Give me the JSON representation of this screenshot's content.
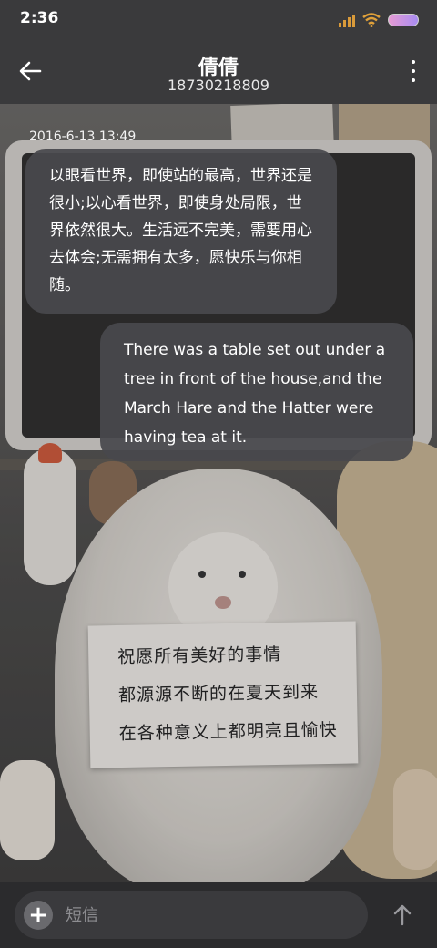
{
  "status_bar": {
    "time": "2:36",
    "icons": [
      "signal-icon",
      "wifi-icon",
      "battery-icon"
    ],
    "signal_color": "#d99a3a",
    "wifi_color": "#e0a13a"
  },
  "header": {
    "contact_name": "倩倩",
    "phone_number": "18730218809",
    "back_icon": "back-arrow-icon",
    "more_icon": "more-vertical-icon"
  },
  "conversation": {
    "timestamp": "2016-6-13 13:49",
    "messages": [
      {
        "direction": "incoming",
        "text": "以眼看世界，即使站的最高，世界还是很小;以心看世界，即使身处局限，世界依然很大。生活远不完美，需要用心去体会;无需拥有太多，愿快乐与你相随。"
      },
      {
        "direction": "outgoing",
        "text": "There was a table set out under a tree in front of the house,and the March Hare and the Hatter were having tea at it."
      }
    ]
  },
  "background_photo": {
    "note_lines": [
      "祝愿所有美好的事情",
      "都源源不断的在夏天到来",
      "在各种意义上都明亮且愉快"
    ]
  },
  "composer": {
    "placeholder": "短信",
    "value": "",
    "add_icon": "plus-icon",
    "send_icon": "send-arrow-up-icon"
  },
  "colors": {
    "bubble_bg": "#48484c",
    "header_bg": "#3a3a3c",
    "composer_bg": "#3a3a3d"
  }
}
